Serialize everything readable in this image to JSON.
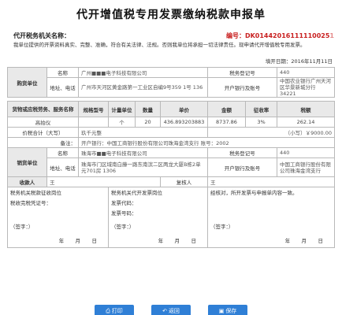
{
  "title": "代开增值税专用发票缴纳税款申报单",
  "tax_office": {
    "label": "代开税务机关名称：",
    "value": ""
  },
  "serial": {
    "label": "编号：",
    "value": "DK01442016111110025",
    "blurred": "1"
  },
  "declaration": "我单位提供的开票资料真实、完整、准确，符合有关法律、法规。否则我单位将承担一切法律责任。现申请代开增值税专用发票。",
  "fill_date": {
    "label": "填开日期：",
    "value": "2016年11月11日"
  },
  "buyer": {
    "group": "购货单位",
    "name_label": "名称",
    "name_value": "广州■■■电子科技有限公司",
    "tax_label": "税务登记号",
    "tax_value": "440",
    "addr_label": "地址、电话",
    "addr_value": "广州市天河区黄金路第一工业区自编9号359 1号 136",
    "bank_label": "开户银行及账号",
    "bank_value": "中国农业银行广州天河区华景新城分行 34221"
  },
  "goods": {
    "headers": [
      "货物或应税劳务、服务名称",
      "规格型号",
      "计量单位",
      "数量",
      "单价",
      "金额",
      "征收率",
      "税额"
    ],
    "rows": [
      [
        "高拍仪",
        "",
        "个",
        "20",
        "436.893203883",
        "8737.86",
        "3%",
        "262.14"
      ]
    ]
  },
  "total": {
    "label": "价税合计（大写）",
    "words": "玖千元整",
    "small_label": "（小写）",
    "small_value": "￥9000.00"
  },
  "remark": {
    "label": "备注：",
    "value": "开户银行：中国工商银行股份有限公司珠海金湾支行 账号：2002"
  },
  "seller": {
    "group": "销货单位",
    "name_label": "名称",
    "name_value": "珠海市■■电子科技有限公司",
    "tax_label": "税务登记号",
    "tax_value": "440",
    "addr_label": "地址、电话",
    "addr_value": "珠海市门区域南白藤一路东南滨二区两龙大厦B栋2单元701房 1306",
    "bank_label": "开户银行及账号",
    "bank_value": "中国工商银行股份有限公司珠海金湾支行"
  },
  "payee": {
    "label": "收款人",
    "value": "王",
    "reviewer_label": "复核人",
    "reviewer_value": "王"
  },
  "bottom": {
    "col1_title": "税务机关税款征收岗位",
    "col1_line": "税收完税凭证号：",
    "col2_title": "税务机关代开发票岗位",
    "col2_line1": "发票代码：",
    "col2_line2": "发票号码：",
    "col3_text": "经核对，所开发票与申报单内容一致。",
    "sign": "（签字：）",
    "y": "年",
    "m": "月",
    "d": "日"
  },
  "buttons": {
    "print": "打印",
    "back": "返回",
    "save": "保存"
  },
  "colors": {
    "title_serial": "#c81e1e",
    "button": "#2f7fd6",
    "header_bg": "#e9e9e9",
    "border": "#b9b9b9"
  }
}
